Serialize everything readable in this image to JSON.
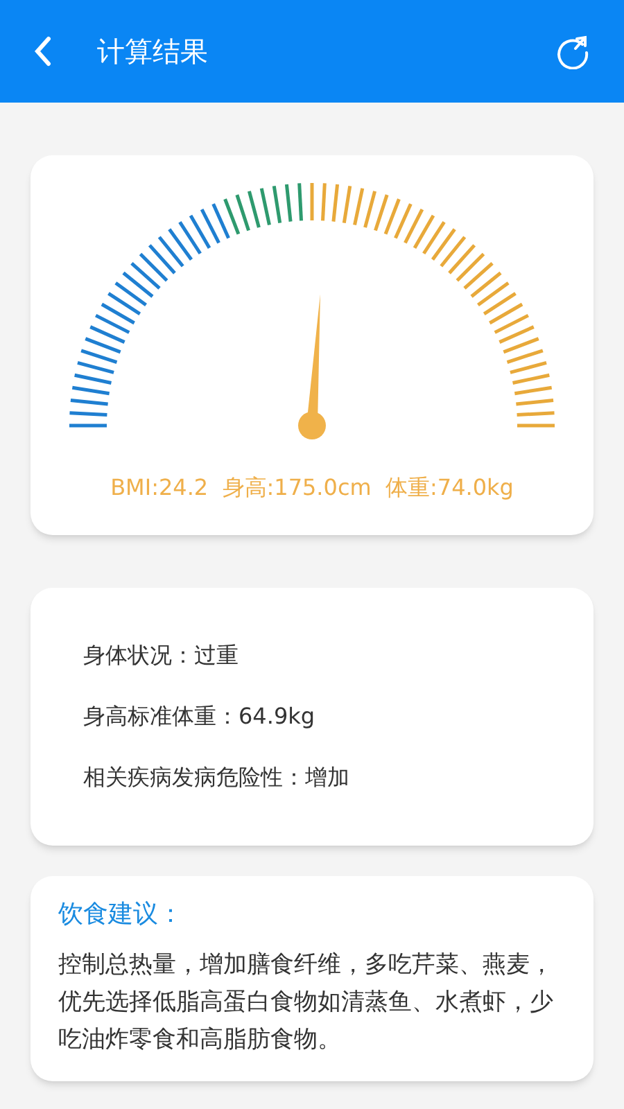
{
  "header": {
    "title": "计算结果"
  },
  "gauge": {
    "summary": "BMI:24.2  身高:175.0cm  体重:74.0kg"
  },
  "status": {
    "items": [
      "身体状况：过重",
      "身高标准体重：64.9kg",
      "相关疾病发病危险性：增加"
    ]
  },
  "advice": {
    "title": "饮食建议：",
    "text": "控制总热量，增加膳食纤维，多吃芹菜、燕麦，优先选择低脂高蛋白食物如清蒸鱼、水煮虾，少吃油炸零食和高脂肪食物。"
  }
}
